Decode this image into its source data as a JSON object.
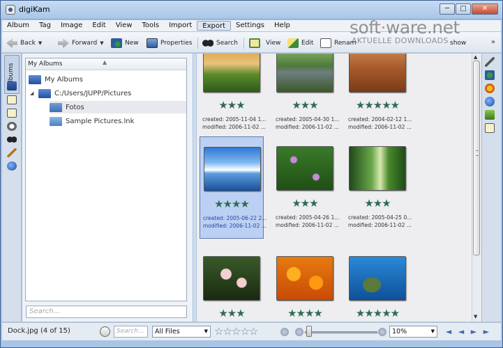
{
  "window": {
    "title": "digiKam"
  },
  "winbtns": {
    "min": "─",
    "max": "□",
    "close": "✕"
  },
  "menu": [
    "Album",
    "Tag",
    "Image",
    "Edit",
    "View",
    "Tools",
    "Import",
    "Export",
    "Settings",
    "Help"
  ],
  "toolbar": {
    "back": "Back",
    "forward": "Forward",
    "new": "New",
    "properties": "Properties",
    "search": "Search",
    "view": "View",
    "edit": "Edit",
    "rename": "Renam",
    "slideshow": "show",
    "more": "»"
  },
  "watermark": {
    "main_a": "soft",
    "main_dot": "·",
    "main_b": "ware.net",
    "sub": "AKTUELLE DOWNLOADS"
  },
  "left_tab": {
    "label": "Albums"
  },
  "tree": {
    "header": "My Albums",
    "header_arrow": "▲",
    "root": "My Albums",
    "path": "C:/Users/JUPP/Pictures",
    "expander": "◢",
    "children": [
      "Fotos",
      "Sample Pictures.lnk"
    ]
  },
  "search": {
    "placeholder": "Search..."
  },
  "thumbs": [
    {
      "stars": "★★★",
      "created": "created: 2005-11-04 1...",
      "modified": "modified: 2006-11-02 ..."
    },
    {
      "stars": "★★★",
      "created": "created: 2005-04-30 1...",
      "modified": "modified: 2006-11-02 ..."
    },
    {
      "stars": "★★★★★",
      "created": "created: 2004-02-12 1...",
      "modified": "modified: 2006-11-02 ..."
    },
    {
      "stars": "★★★★",
      "created": "created: 2005-06-22 2...",
      "modified": "modified: 2006-11-02 ..."
    },
    {
      "stars": "★★★",
      "created": "created: 2005-04-26 1...",
      "modified": "modified: 2006-11-02 ..."
    },
    {
      "stars": "★★★",
      "created": "created: 2005-04-25 0...",
      "modified": "modified: 2006-11-02 ..."
    },
    {
      "stars": "★★★",
      "created": "",
      "modified": ""
    },
    {
      "stars": "★★★★",
      "created": "",
      "modified": ""
    },
    {
      "stars": "★★★★★",
      "created": "",
      "modified": ""
    }
  ],
  "scroll": {
    "up": "▲",
    "down": "▼"
  },
  "status": {
    "file": "Dock.jpg (4 of 15)",
    "search_placeholder": "Search...",
    "filter": "All Files",
    "filter_arrow": "▼",
    "rating": "☆☆☆☆☆",
    "zoom": "10%",
    "zoom_arrow": "▼",
    "nav": [
      "◄",
      "◄",
      "►",
      "►"
    ]
  }
}
